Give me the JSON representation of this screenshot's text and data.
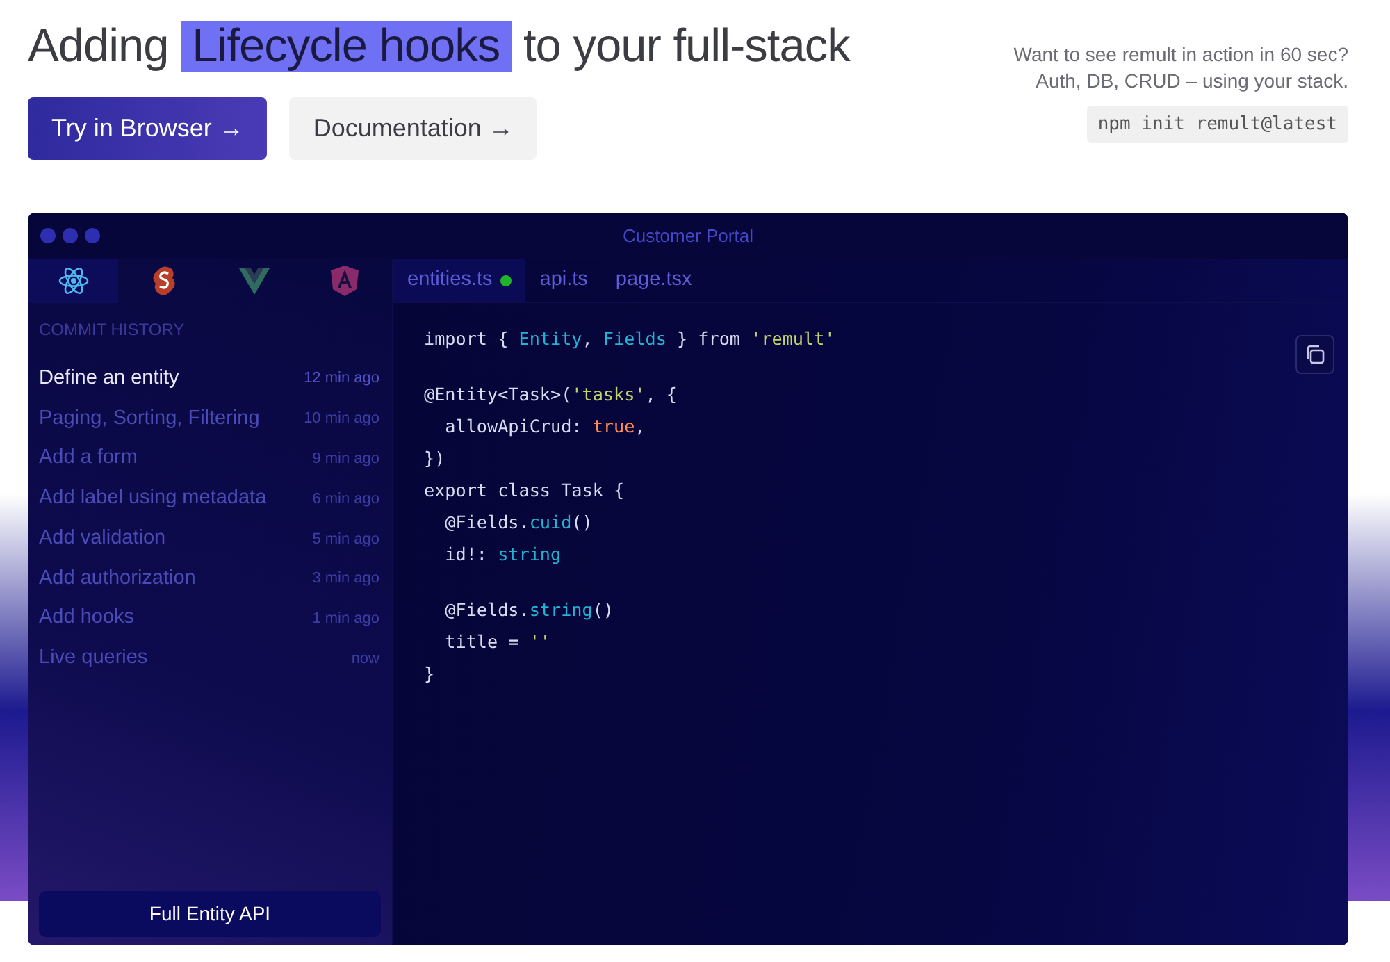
{
  "hero": {
    "title_before": "Adding",
    "highlight": "Lifecycle hooks",
    "title_after": "to your full-stack",
    "buttons": [
      {
        "label": "Try in Browser →",
        "kind": "primary"
      },
      {
        "label": "Documentation →",
        "kind": "secondary"
      }
    ],
    "tagline_lines": [
      "Want to see remult in action in 60 sec?",
      "Auth, DB, CRUD – using your stack."
    ],
    "command": "npm init remult@latest"
  },
  "window": {
    "title": "Customer Portal",
    "framework_tabs": [
      {
        "kind": "react",
        "selected": true
      },
      {
        "kind": "svelte",
        "selected": false
      },
      {
        "kind": "vue",
        "selected": false
      },
      {
        "kind": "angular",
        "selected": false
      }
    ],
    "file_tabs": [
      {
        "label": "entities.ts",
        "selected": true,
        "modified": true
      },
      {
        "label": "api.ts",
        "selected": false,
        "modified": false
      },
      {
        "label": "page.tsx",
        "selected": false,
        "modified": false
      }
    ],
    "sidebar": {
      "heading": "COMMIT HISTORY",
      "items": [
        {
          "label": "Define an entity",
          "time": "12 min ago",
          "selected": true
        },
        {
          "label": "Paging, Sorting, Filtering",
          "time": "10 min ago",
          "selected": false
        },
        {
          "label": "Add a form",
          "time": "9 min ago",
          "selected": false
        },
        {
          "label": "Add label using metadata",
          "time": "6 min ago",
          "selected": false
        },
        {
          "label": "Add validation",
          "time": "5 min ago",
          "selected": false
        },
        {
          "label": "Add authorization",
          "time": "3 min ago",
          "selected": false
        },
        {
          "label": "Add hooks",
          "time": "1 min ago",
          "selected": false
        },
        {
          "label": "Live queries",
          "time": "now",
          "selected": false
        }
      ],
      "footer_button": "Full Entity API"
    },
    "code_lines": [
      {
        "kind": "code",
        "tokens": [
          {
            "text": "import { ",
            "kind": "plain"
          },
          {
            "text": "Entity",
            "kind": "ident"
          },
          {
            "text": ", ",
            "kind": "plain"
          },
          {
            "text": "Fields",
            "kind": "ident"
          },
          {
            "text": " } from ",
            "kind": "plain"
          },
          {
            "text": "'remult'",
            "kind": "string"
          }
        ]
      },
      {
        "kind": "blank"
      },
      {
        "kind": "code",
        "tokens": [
          {
            "text": "@Entity<Task>(",
            "kind": "plain"
          },
          {
            "text": "'tasks'",
            "kind": "string"
          },
          {
            "text": ", {",
            "kind": "plain"
          }
        ]
      },
      {
        "kind": "code",
        "tokens": [
          {
            "text": "  allowApiCrud: ",
            "kind": "plain"
          },
          {
            "text": "true",
            "kind": "bool"
          },
          {
            "text": ",",
            "kind": "plain"
          }
        ]
      },
      {
        "kind": "code",
        "tokens": [
          {
            "text": "})",
            "kind": "plain"
          }
        ]
      },
      {
        "kind": "code",
        "tokens": [
          {
            "text": "export class Task {",
            "kind": "plain"
          }
        ]
      },
      {
        "kind": "code",
        "tokens": [
          {
            "text": "  @Fields.",
            "kind": "plain"
          },
          {
            "text": "cuid",
            "kind": "ident"
          },
          {
            "text": "()",
            "kind": "plain"
          }
        ]
      },
      {
        "kind": "code",
        "tokens": [
          {
            "text": "  id!: ",
            "kind": "plain"
          },
          {
            "text": "string",
            "kind": "ident"
          }
        ]
      },
      {
        "kind": "blank"
      },
      {
        "kind": "code",
        "tokens": [
          {
            "text": "  @Fields.",
            "kind": "plain"
          },
          {
            "text": "string",
            "kind": "ident"
          },
          {
            "text": "()",
            "kind": "plain"
          }
        ]
      },
      {
        "kind": "code",
        "tokens": [
          {
            "text": "  title = ",
            "kind": "plain"
          },
          {
            "text": "''",
            "kind": "string"
          }
        ]
      },
      {
        "kind": "code",
        "tokens": [
          {
            "text": "}",
            "kind": "plain"
          }
        ]
      }
    ]
  }
}
